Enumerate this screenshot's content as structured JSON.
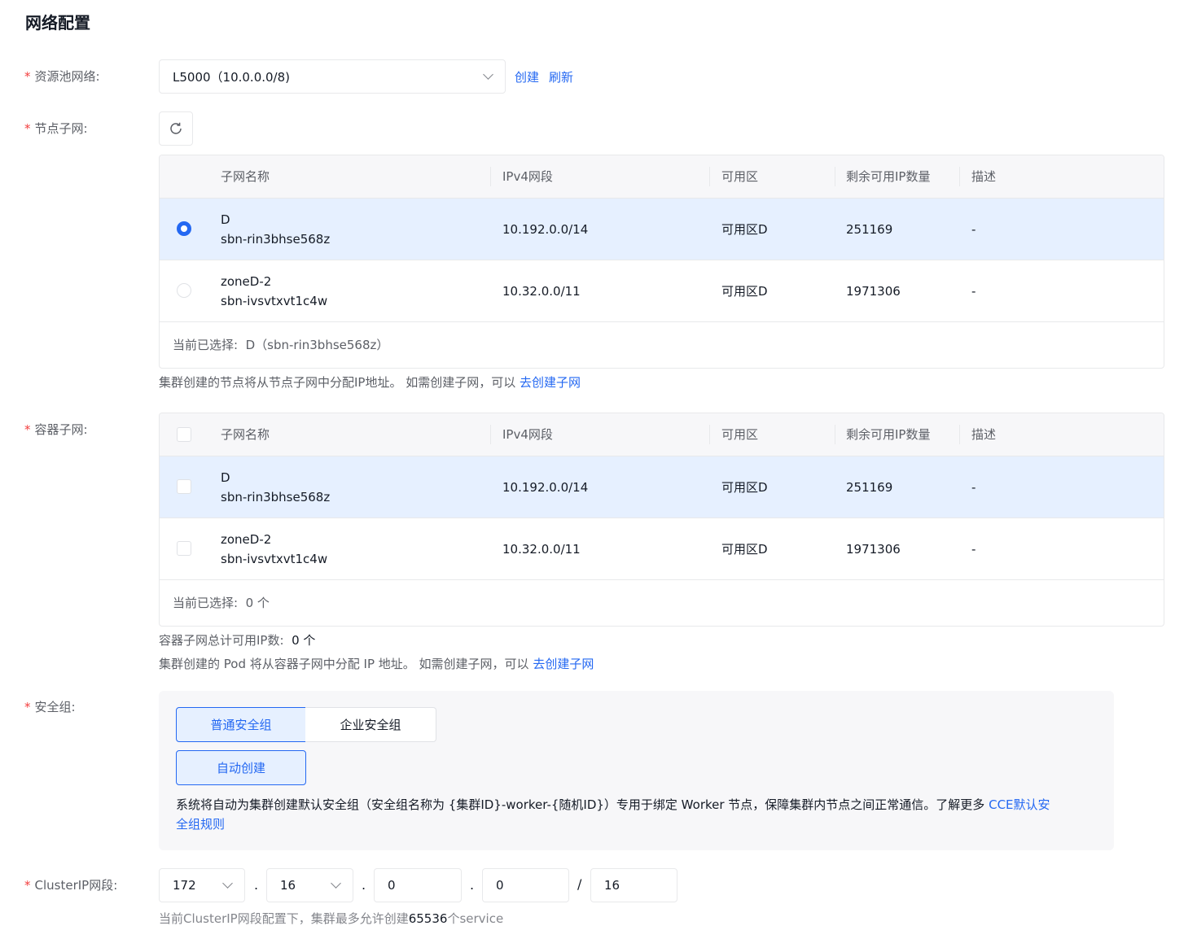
{
  "page": {
    "title": "网络配置"
  },
  "vpc": {
    "label": "资源池网络:",
    "selected": "L5000（10.0.0.0/8)",
    "create_link": "创建",
    "refresh_link": "刷新"
  },
  "node_subnet": {
    "label": "节点子网:",
    "columns": [
      "子网名称",
      "IPv4网段",
      "可用区",
      "剩余可用IP数量",
      "描述"
    ],
    "rows": [
      {
        "name": "D",
        "id": "sbn-rin3bhse568z",
        "cidr": "10.192.0.0/14",
        "zone": "可用区D",
        "available": "251169",
        "desc": "-",
        "selected": true
      },
      {
        "name": "zoneD-2",
        "id": "sbn-ivsvtxvt1c4w",
        "cidr": "10.32.0.0/11",
        "zone": "可用区D",
        "available": "1971306",
        "desc": "-",
        "selected": false
      }
    ],
    "footer_label": "当前已选择:",
    "footer_value": "D（sbn-rin3bhse568z）",
    "hint_text": "集群创建的节点将从节点子网中分配IP地址。 如需创建子网，可以",
    "hint_link": "去创建子网"
  },
  "container_subnet": {
    "label": "容器子网:",
    "columns": [
      "子网名称",
      "IPv4网段",
      "可用区",
      "剩余可用IP数量",
      "描述"
    ],
    "rows": [
      {
        "name": "D",
        "id": "sbn-rin3bhse568z",
        "cidr": "10.192.0.0/14",
        "zone": "可用区D",
        "available": "251169",
        "desc": "-"
      },
      {
        "name": "zoneD-2",
        "id": "sbn-ivsvtxvt1c4w",
        "cidr": "10.32.0.0/11",
        "zone": "可用区D",
        "available": "1971306",
        "desc": "-"
      }
    ],
    "footer_label": "当前已选择:",
    "footer_value": "0 个",
    "total_label": "容器子网总计可用IP数:",
    "total_value": "0 个",
    "hint_text": "集群创建的 Pod 将从容器子网中分配 IP 地址。 如需创建子网，可以",
    "hint_link": "去创建子网"
  },
  "security_group": {
    "label": "安全组:",
    "tab_normal": "普通安全组",
    "tab_enterprise": "企业安全组",
    "auto_create": "自动创建",
    "desc_line1": "系统将自动为集群创建默认安全组（安全组名称为 {集群ID}-worker-{随机ID}）专用于绑定 Worker 节点，保障集群内节点之间正常通信。了解更多",
    "desc_link1": "CCE默认安",
    "desc_link2": "全组规则"
  },
  "cluster_ip": {
    "label": "ClusterIP网段:",
    "octet1": "172",
    "octet2": "16",
    "octet3": "0",
    "octet4": "0",
    "mask": "16",
    "dot": ".",
    "slash": "/",
    "hint_prefix": "当前ClusterIP网段配置下，集群最多允许创建",
    "hint_number": "65536",
    "hint_suffix": "个service"
  },
  "colors": {
    "primary": "#2468f2",
    "required": "#f33e3e",
    "selected_row": "#e6f0ff"
  }
}
